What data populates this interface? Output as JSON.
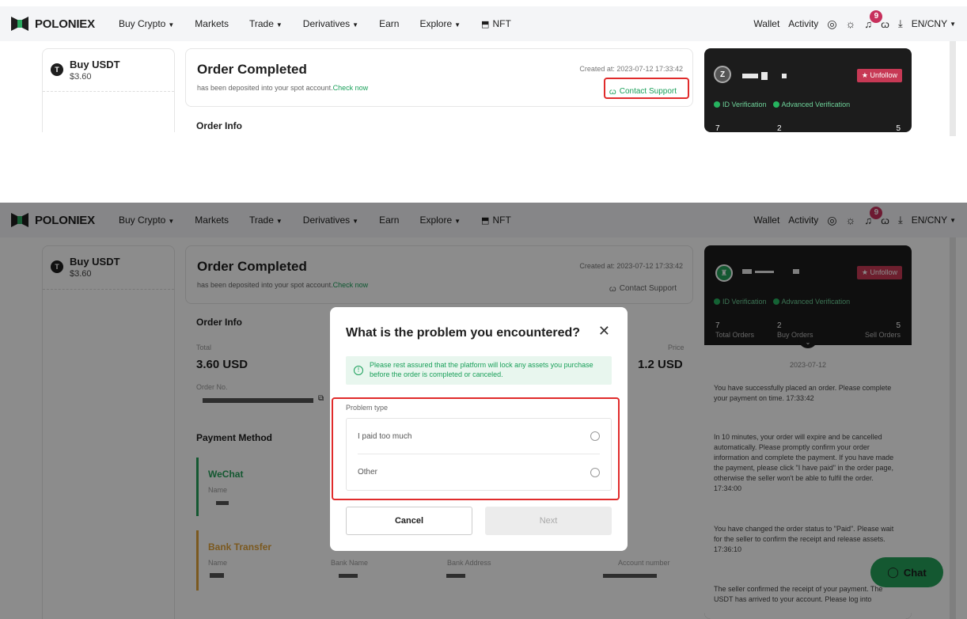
{
  "nav": {
    "logo": "POLONIEX",
    "links": [
      {
        "label": "Buy Crypto",
        "caret": true
      },
      {
        "label": "Markets",
        "caret": false
      },
      {
        "label": "Trade",
        "caret": true
      },
      {
        "label": "Derivatives",
        "caret": true
      },
      {
        "label": "Earn",
        "caret": false
      },
      {
        "label": "Explore",
        "caret": true
      },
      {
        "label": "NFT",
        "caret": false
      }
    ],
    "wallet": "Wallet",
    "activity": "Activity",
    "notifications": "9",
    "language": "EN/CNY"
  },
  "buy": {
    "title": "Buy USDT",
    "price": "$3.60"
  },
  "order": {
    "title": "Order Completed",
    "subtitle": "has been deposited into your spot account.",
    "check_now": "Check now",
    "created": "Created at: 2023-07-12 17:33:42",
    "support": "Contact Support",
    "info_title": "Order Info",
    "total_label": "Total",
    "total_value": "3.60 USD",
    "price_label": "Price",
    "price_value": "1.2 USD",
    "order_no_label": "Order No.",
    "payment_title": "Payment Method",
    "wechat": "WeChat",
    "name_label": "Name",
    "bank_transfer": "Bank Transfer",
    "bank_name_label": "Bank Name",
    "bank_address_label": "Bank Address",
    "account_number_label": "Account number"
  },
  "merchant": {
    "avatar_top": "Z",
    "unfollow": "Unfollow",
    "id_verification": "ID Verification",
    "advanced_verification": "Advanced Verification",
    "total_orders": "7",
    "total_orders_label": "Total Orders",
    "buy_orders": "2",
    "buy_orders_label": "Buy Orders",
    "sell_orders": "5",
    "sell_orders_label": "Sell Orders"
  },
  "chat_log": {
    "date": "2023-07-12",
    "messages": [
      "You have successfully placed an order. Please complete your payment on time. 17:33:42",
      "In 10 minutes, your order will expire and be cancelled automatically. Please promptly confirm your order information and complete the payment. If you have made the payment, please click \"I have paid\" in the order page, otherwise the seller won't be able to fulfil the order. 17:34:00",
      "You have changed the order status to \"Paid\". Please wait for the seller to confirm the receipt and release assets. 17:36:10",
      "The seller confirmed the receipt of your payment. The USDT has arrived to your account. Please log into"
    ]
  },
  "modal": {
    "title": "What is the problem you encountered?",
    "alert": "Please rest assured that the platform will lock any assets you purchase before the order is completed or canceled.",
    "problem_type_label": "Problem type",
    "options": [
      "I paid too much",
      "Other"
    ],
    "cancel": "Cancel",
    "next": "Next"
  },
  "chat_button": "Chat",
  "colors": {
    "accent": "#1aa05a",
    "highlight": "#e02b2b",
    "badge": "#c7305c"
  }
}
